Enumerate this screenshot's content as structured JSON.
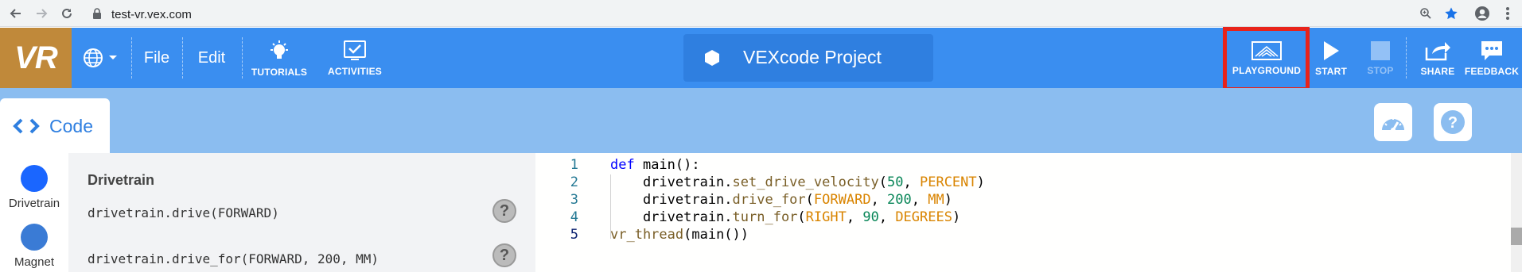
{
  "browser": {
    "url": "test-vr.vex.com",
    "icons": [
      "back-icon",
      "forward-icon",
      "reload-icon",
      "lock-icon",
      "zoom-icon",
      "bookmark-star-icon",
      "profile-icon",
      "more-icon"
    ]
  },
  "app": {
    "logo_text": "VR",
    "menu": {
      "file": "File",
      "edit": "Edit"
    },
    "tutorials_label": "TUTORIALS",
    "activities_label": "ACTIVITIES",
    "project_name": "VEXcode Project",
    "actions": {
      "playground": "PLAYGROUND",
      "start": "START",
      "stop": "STOP",
      "share": "SHARE",
      "feedback": "FEEDBACK"
    },
    "highlight_color": "#e8231a",
    "brand_color": "#3a8ef0",
    "logo_color": "#c0893a"
  },
  "tabs": {
    "code_label": "Code"
  },
  "palette": {
    "categories": [
      {
        "label": "Drivetrain",
        "color": "#1a66ff"
      },
      {
        "label": "Magnet",
        "color": "#3a7bd5"
      }
    ],
    "section_title": "Drivetrain",
    "blocks": [
      "drivetrain.drive(FORWARD)",
      "drivetrain.drive_for(FORWARD, 200, MM)"
    ],
    "help_glyph": "?"
  },
  "editor": {
    "line_numbers": [
      "1",
      "2",
      "3",
      "4",
      "5"
    ],
    "lines": [
      [
        {
          "t": "def",
          "c": "kw"
        },
        {
          "t": " main():",
          "c": ""
        }
      ],
      [
        {
          "t": "    drivetrain.",
          "c": ""
        },
        {
          "t": "set_drive_velocity",
          "c": "fn"
        },
        {
          "t": "(",
          "c": ""
        },
        {
          "t": "50",
          "c": "num"
        },
        {
          "t": ", ",
          "c": ""
        },
        {
          "t": "PERCENT",
          "c": "cs"
        },
        {
          "t": ")",
          "c": ""
        }
      ],
      [
        {
          "t": "    drivetrain.",
          "c": ""
        },
        {
          "t": "drive_for",
          "c": "fn"
        },
        {
          "t": "(",
          "c": ""
        },
        {
          "t": "FORWARD",
          "c": "cs"
        },
        {
          "t": ", ",
          "c": ""
        },
        {
          "t": "200",
          "c": "num"
        },
        {
          "t": ", ",
          "c": ""
        },
        {
          "t": "MM",
          "c": "cs"
        },
        {
          "t": ")",
          "c": ""
        }
      ],
      [
        {
          "t": "    drivetrain.",
          "c": ""
        },
        {
          "t": "turn_for",
          "c": "fn"
        },
        {
          "t": "(",
          "c": ""
        },
        {
          "t": "RIGHT",
          "c": "cs"
        },
        {
          "t": ", ",
          "c": ""
        },
        {
          "t": "90",
          "c": "num"
        },
        {
          "t": ", ",
          "c": ""
        },
        {
          "t": "DEGREES",
          "c": "cs"
        },
        {
          "t": ")",
          "c": ""
        }
      ],
      [
        {
          "t": "vr_thread",
          "c": "fn"
        },
        {
          "t": "(main())",
          "c": ""
        }
      ]
    ]
  }
}
